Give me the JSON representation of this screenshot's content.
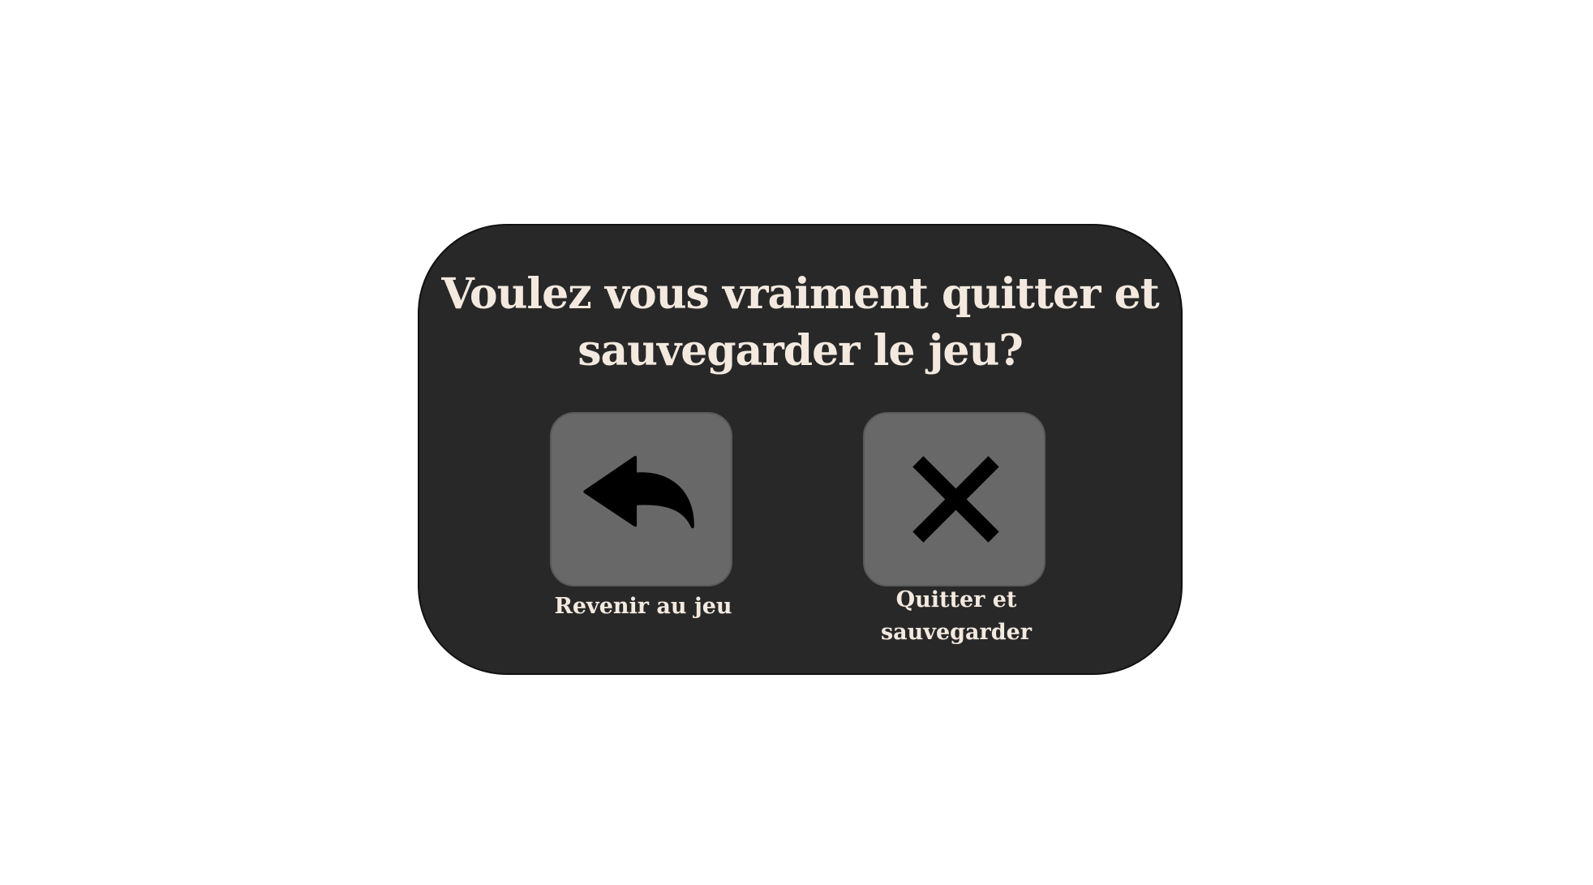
{
  "dialog": {
    "question": "Voulez vous vraiment quitter et sauvegarder le jeu?",
    "actions": [
      {
        "label": "Revenir au jeu",
        "icon": "back-arrow-icon"
      },
      {
        "label": "Quitter et sauvegarder",
        "icon": "close-x-icon"
      }
    ]
  },
  "colors": {
    "page_background": "#ffffff",
    "dialog_background": "#282828",
    "button_background": "#686868",
    "text": "#f3e9df",
    "icon": "#000000"
  }
}
